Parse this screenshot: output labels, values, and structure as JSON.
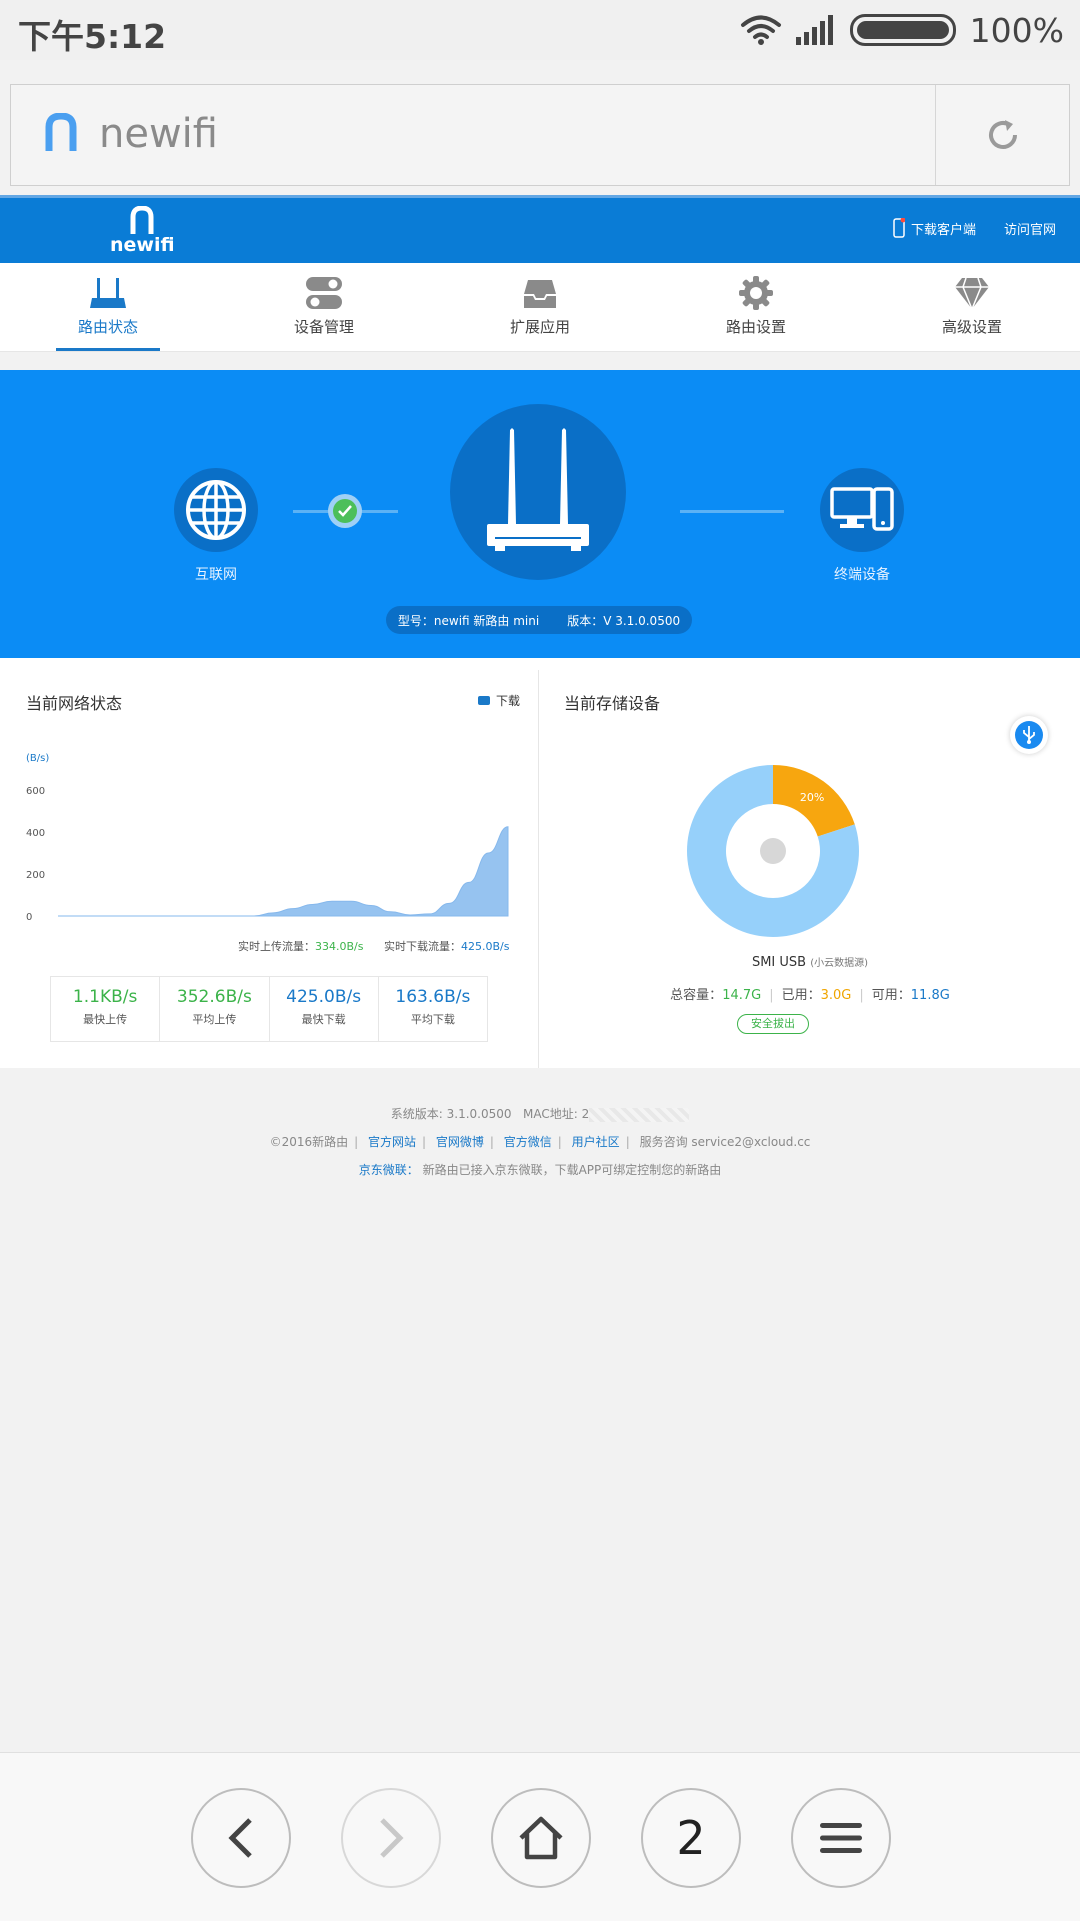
{
  "status_bar": {
    "time": "下午5:12",
    "battery": "100%"
  },
  "url_bar": {
    "text": "newifi"
  },
  "header": {
    "brand": "newifi",
    "download_client": "下载客户端",
    "visit_site": "访问官网"
  },
  "nav_tabs": [
    {
      "label": "路由状态",
      "icon": "router-icon",
      "active": true
    },
    {
      "label": "设备管理",
      "icon": "toggle-switch-icon",
      "active": false
    },
    {
      "label": "扩展应用",
      "icon": "inbox-tray-icon",
      "active": false
    },
    {
      "label": "路由设置",
      "icon": "gear-icon",
      "active": false
    },
    {
      "label": "高级设置",
      "icon": "diamond-icon",
      "active": false
    }
  ],
  "hero": {
    "internet_label": "互联网",
    "terminal_label": "终端设备",
    "model": "型号：newifi 新路由 mini",
    "version": "版本：V 3.1.0.0500"
  },
  "network": {
    "title": "当前网络状态",
    "legend": "下载",
    "y_unit": "(B/s)",
    "realtime_upload_label": "实时上传流量：",
    "realtime_upload_value": "334.0B/s",
    "realtime_download_label": "实时下载流量：",
    "realtime_download_value": "425.0B/s",
    "stats": [
      {
        "value": "1.1KB/s",
        "caption": "最快上传",
        "color": "#3cb34a"
      },
      {
        "value": "352.6B/s",
        "caption": "平均上传",
        "color": "#3cb34a"
      },
      {
        "value": "425.0B/s",
        "caption": "最快下载",
        "color": "#1a79c8"
      },
      {
        "value": "163.6B/s",
        "caption": "平均下载",
        "color": "#1a79c8"
      }
    ]
  },
  "storage": {
    "title": "当前存储设备",
    "device": "SMI USB",
    "device_sub": "(小云数据源)",
    "total_label": "总容量：",
    "total_value": "14.7G",
    "used_label": "已用：",
    "used_value": "3.0G",
    "avail_label": "可用：",
    "avail_value": "11.8G",
    "eject": "安全拔出"
  },
  "chart_data": [
    {
      "type": "area",
      "ylabel": "(B/s)",
      "ylim": [
        0,
        600
      ],
      "yticks": [
        0,
        200,
        400,
        600
      ],
      "series": [
        {
          "name": "下载",
          "values": [
            0,
            0,
            0,
            0,
            0,
            0,
            0,
            0,
            0,
            0,
            0,
            15,
            35,
            55,
            70,
            70,
            50,
            20,
            5,
            10,
            60,
            160,
            300,
            425
          ]
        }
      ],
      "grid": false,
      "legend": "top-right"
    },
    {
      "type": "pie",
      "donut": true,
      "slices": [
        {
          "label": "20%",
          "value": 20,
          "color": "#f7a60f"
        },
        {
          "value": 80,
          "color": "#96d0fa"
        }
      ]
    }
  ],
  "footer": {
    "sys_version": "系统版本:  3.1.0.0500",
    "mac_label": "MAC地址:  2",
    "copyright": "©2016新路由",
    "links": [
      "官方网站",
      "官网微博",
      "官方微信",
      "用户社区"
    ],
    "service": "服务咨询 service2@xcloud.cc",
    "jd_label": "京东微联：",
    "jd_text": "新路由已接入京东微联，下载APP可绑定控制您的新路由"
  },
  "bottom_nav": {
    "tab_count": "2"
  }
}
